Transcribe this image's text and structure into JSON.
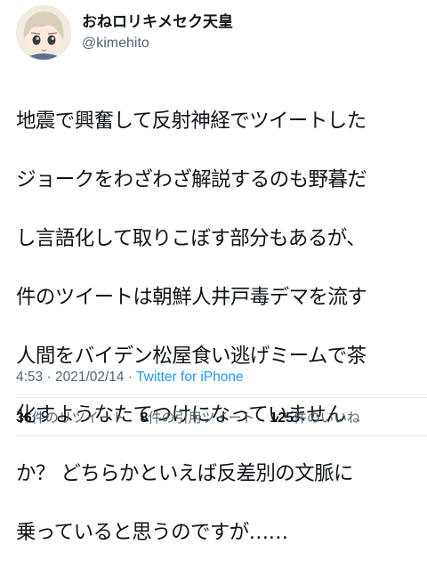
{
  "tweet": {
    "author": {
      "display_name": "おねロリキメセク天皇",
      "handle": "@kimehito"
    },
    "text_lines": [
      "地震で興奮して反射神経でツイートした",
      "ジョークをわざわざ解説するのも野暮だ",
      "し言語化して取りこぼす部分もあるが、",
      "件のツイートは朝鮮人井戸毒デマを流す",
      "人間をバイデン松屋食い逃げミームで茶",
      "化すようなたてつけになっていません",
      "か？ どちらかといえば反差別の文脈に",
      "乗っていると思うのですが……"
    ],
    "time": "4:53",
    "separator": "·",
    "date": "2021/02/14",
    "source": "Twitter for iPhone",
    "stats": [
      {
        "count": "36",
        "label": "件のリツイート"
      },
      {
        "count": "8",
        "label": "件の引用ツイート"
      },
      {
        "count": "125",
        "label": "件のいいね"
      }
    ]
  },
  "icons": {
    "avatar": "anime-character-avatar"
  },
  "colors": {
    "text": "#0f1419",
    "secondary": "#536471",
    "link": "#1d9bf0"
  }
}
